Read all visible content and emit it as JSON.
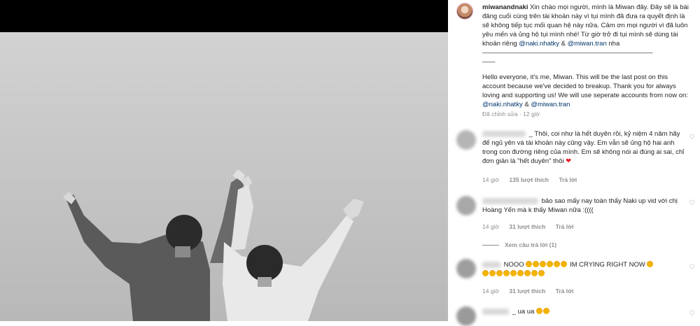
{
  "post": {
    "username": "miwanandnaki",
    "caption_vi": "Xin chào mọi người, mình là Miwan đây. Đây sẽ là bài đăng cuối cùng trên tài khoản này vì tụi mình đã đưa ra quyết định là sẽ không tiếp tục mối quan hệ này nữa. Cảm ơn mọi người vì đã luôn yêu mến và ủng hộ tụi mình nhé! Từ giờ trở đi tụi mình sẽ dùng tài khoản riêng",
    "mention1": "@naki.nhatky",
    "amp": "&",
    "mention2": "@miwan.tran",
    "caption_vi_end": "nha",
    "rule": "———————————————————————————",
    "rule2": "——",
    "caption_en": "Hello everyone, it's me, Miwan. This will be the last post on this account because we've decided to breakup. Thank you for always loving and supporting us! We will use seperate accounts from now on:",
    "edited": "Đã chỉnh sửa · 12 giờ"
  },
  "comments": [
    {
      "text": "_ Thôi, coi như là hết duyên rồi, kỷ niệm 4 năm hãy để ngủ yên và tài khoản này cũng vậy. Em vẫn sẽ ủng hộ hai anh trong con đường riêng của mình. Em sẽ không nói ai đúng ai sai, chỉ đơn giản là \"hết duyên\" thôi",
      "time": "14 giờ",
      "likes": "135 lượt thích",
      "reply": "Trả lời"
    },
    {
      "text": "bảo sao mấy nay toàn thấy Naki up vid với chị Hoàng Yến mà k thấy Miwan nữa :((((",
      "time": "14 giờ",
      "likes": "31 lượt thích",
      "reply": "Trả lời",
      "view_replies": "Xem câu trả lời (1)"
    },
    {
      "text": "NOOO",
      "text2": "IM CRYING RIGHT NOW",
      "time": "14 giờ",
      "likes": "31 lượt thích",
      "reply": "Trả lời"
    },
    {
      "text": "_ ua ua"
    }
  ],
  "icons": {
    "heart": "heart-outline-icon",
    "emoji": "crying-emoji-icon",
    "red_heart": "red-heart-emoji"
  },
  "colors": {
    "mention": "#00376b",
    "meta": "#8e8e8e",
    "red_heart": "#ed1c24"
  }
}
